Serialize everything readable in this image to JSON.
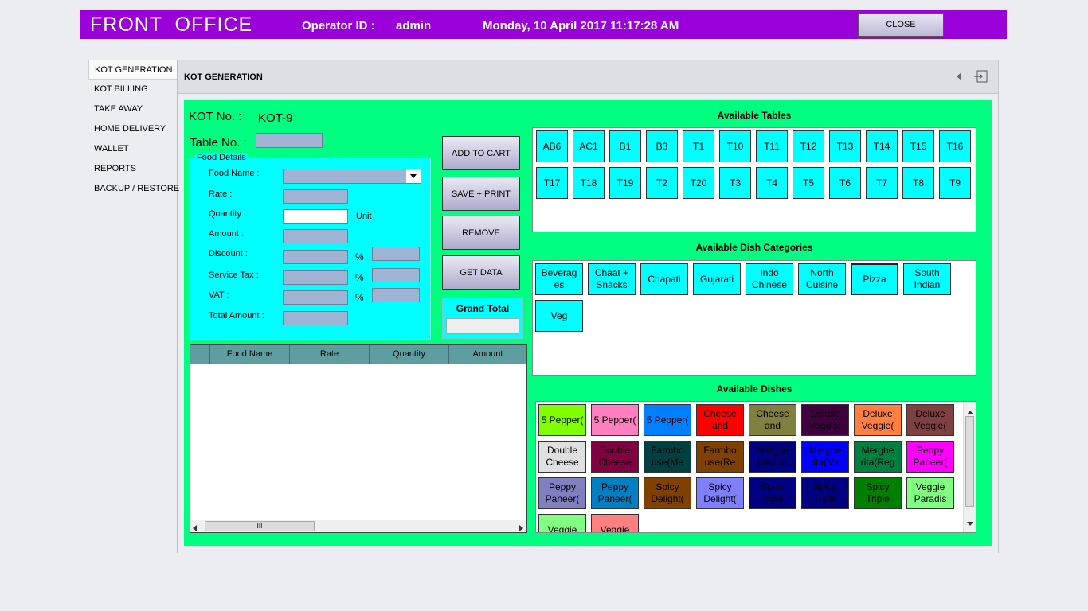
{
  "header": {
    "title": "FRONT  OFFICE",
    "operator_label": "Operator ID :",
    "operator_value": "admin",
    "datetime": "Monday, 10 April 2017 11:17:28 AM",
    "close_label": "CLOSE"
  },
  "sidebar": {
    "items": [
      {
        "label": "KOT GENERATION"
      },
      {
        "label": "KOT BILLING"
      },
      {
        "label": "TAKE AWAY"
      },
      {
        "label": "HOME DELIVERY"
      },
      {
        "label": "WALLET"
      },
      {
        "label": "REPORTS"
      },
      {
        "label": "BACKUP / RESTORE"
      }
    ]
  },
  "page": {
    "title": "KOT GENERATION"
  },
  "kot": {
    "kot_no_label": "KOT No. :",
    "kot_no_value": "KOT-9",
    "table_no_label": "Table No. :"
  },
  "food_details": {
    "title": "Food Details",
    "food_name_label": "Food Name :",
    "rate_label": "Rate :",
    "quantity_label": "Quantity :",
    "unit_label": "Unit",
    "amount_label": "Amount :",
    "discount_label": "Discount :",
    "service_tax_label": "Service Tax :",
    "vat_label": "VAT :",
    "total_amount_label": "Total Amount :",
    "percent": "%"
  },
  "actions": {
    "add_to_cart": "ADD TO CART",
    "save_print": "SAVE + PRINT",
    "remove": "REMOVE",
    "get_data": "GET DATA"
  },
  "grand_total": {
    "label": "Grand Total"
  },
  "cart_grid": {
    "columns": [
      "Food Name",
      "Rate",
      "Quantity",
      "Amount"
    ],
    "scroll_grip": "III"
  },
  "tables": {
    "title": "Available Tables",
    "items": [
      "AB6",
      "AC1",
      "B1",
      "B3",
      "T1",
      "T10",
      "T11",
      "T12",
      "T13",
      "T14",
      "T15",
      "T16",
      "T17",
      "T18",
      "T19",
      "T2",
      "T20",
      "T3",
      "T4",
      "T5",
      "T6",
      "T7",
      "T8",
      "T9"
    ]
  },
  "categories": {
    "title": "Available Dish Categories",
    "items": [
      "Beverag es",
      "Chaat + Snacks",
      "Chapati",
      "Gujarati",
      "Indo Chinese",
      "North Cuisine",
      "Pizza",
      "South Indian",
      "Veg"
    ],
    "selected": "Pizza"
  },
  "dishes": {
    "title": "Available Dishes",
    "items": [
      {
        "label": "5 Pepper(",
        "color": "#80ff00"
      },
      {
        "label": "5 Pepper(",
        "color": "#ff80c0"
      },
      {
        "label": "5 Pepper(",
        "color": "#0080ff"
      },
      {
        "label": "Cheese and",
        "color": "#ff0000"
      },
      {
        "label": "Cheese and",
        "color": "#808040"
      },
      {
        "label": "Deluxe Veggie(",
        "color": "#400040"
      },
      {
        "label": "Deluxe Veggie(",
        "color": "#ff8040"
      },
      {
        "label": "Deluxe Veggie(",
        "color": "#804040"
      },
      {
        "label": "Double Cheese",
        "color": "#e0e0e0"
      },
      {
        "label": "Double Cheese",
        "color": "#800040"
      },
      {
        "label": "Farmho use(Me",
        "color": "#004040"
      },
      {
        "label": "Farmho use(Re",
        "color": "#804000"
      },
      {
        "label": "Merghe rita(Lar",
        "color": "#000080"
      },
      {
        "label": "Merghe rita(Me",
        "color": "#0000ff"
      },
      {
        "label": "Merghe rita(Reg",
        "color": "#008040"
      },
      {
        "label": "Peppy Paneer(",
        "color": "#ff00ff"
      },
      {
        "label": "Peppy Paneer(",
        "color": "#8080c0"
      },
      {
        "label": "Peppy Paneer(",
        "color": "#0080c0"
      },
      {
        "label": "Spicy Delight(",
        "color": "#804000"
      },
      {
        "label": "Spicy Delight(",
        "color": "#8080ff"
      },
      {
        "label": "Spicy Triple",
        "color": "#000080"
      },
      {
        "label": "Spicy Triple",
        "color": "#000080"
      },
      {
        "label": "Spicy Triple",
        "color": "#008000"
      },
      {
        "label": "Veggie Paradis",
        "color": "#80ff80"
      },
      {
        "label": "Veggie",
        "color": "#80ff80"
      },
      {
        "label": "Veggie",
        "color": "#ff8080"
      }
    ]
  }
}
